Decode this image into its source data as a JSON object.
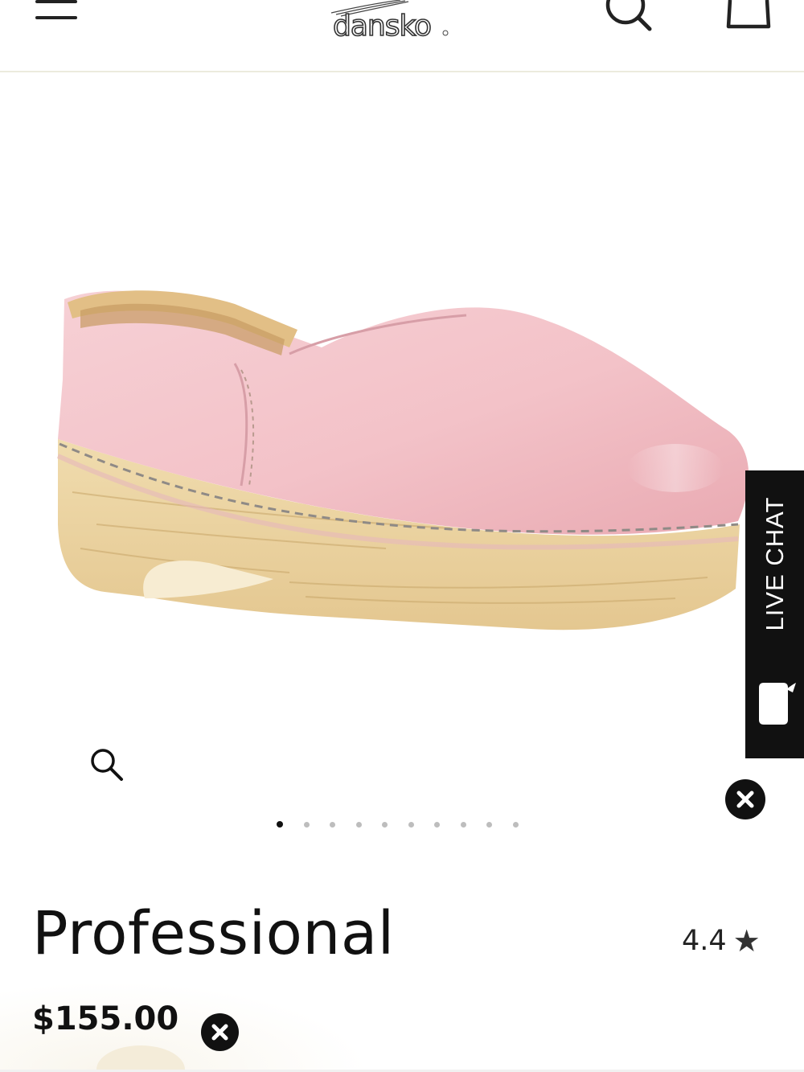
{
  "header": {
    "menu_icon": "hamburger-menu-icon",
    "logo_text": "dansko",
    "logo_mark": "®",
    "search_icon": "search-icon",
    "bag_icon": "shopping-bag-icon"
  },
  "gallery": {
    "image_alt": "Pink leather clog with wood-grain sole",
    "zoom_icon": "zoom-icon",
    "slide_count": 10,
    "active_slide": 1
  },
  "live_chat": {
    "label": "LIVE CHAT",
    "icon": "chat-bubble-icon"
  },
  "product": {
    "title": "Professional",
    "rating": "4.4",
    "rating_icon": "star-icon",
    "price": "$155.00"
  },
  "colors": {
    "brand_dark": "#111111",
    "header_border": "#ecebdd",
    "shoe_pink": "#f2c3c9",
    "sole_wood": "#ecd3a3"
  }
}
